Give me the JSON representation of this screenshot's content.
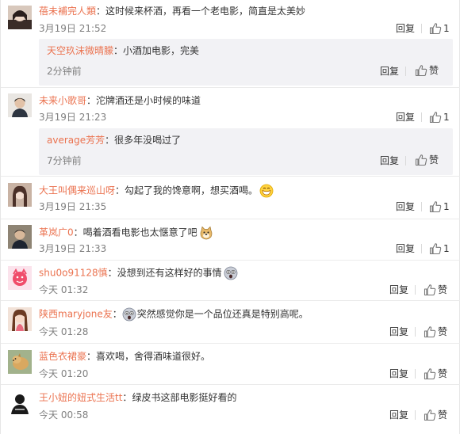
{
  "actions": {
    "reply_label": "回复",
    "like_label": "赞"
  },
  "comments": [
    {
      "user": "蓓未補完人類",
      "text": "这时候来杯酒，再看一个老电影，简直是太美妙",
      "time": "3月19日 21:52",
      "like_value": "1",
      "reply": {
        "user": "天空玖沫微晴朦",
        "text": "小酒加电影，完美",
        "time": "2分钟前"
      }
    },
    {
      "user": "未来小歌哥",
      "text": "沱牌酒还是小时候的味道",
      "time": "3月19日 21:23",
      "like_value": "1",
      "reply": {
        "user": "average芳芳",
        "text": "很多年没喝过了",
        "time": "7分钟前"
      }
    },
    {
      "user": "大王叫偶来巡山呀",
      "text": "勾起了我的馋意啊，想买酒喝。",
      "time": "3月19日 21:35",
      "like_value": "1",
      "emoji": "grin-emoji"
    },
    {
      "user": "革岚广0",
      "text": "喝着酒看电影也太惬意了吧",
      "time": "3月19日 21:33",
      "like_value": "1",
      "emoji": "doge-emoji"
    },
    {
      "user": "shu0o91128慎",
      "text": "没想到还有这样好的事情",
      "time": "今天 01:32",
      "like_value": "赞",
      "emoji": "shocked-emoji"
    },
    {
      "user": "陕西maryjone友",
      "text": "突然感觉你是一个品位还真是特别高呢。",
      "time": "今天 01:28",
      "like_value": "赞",
      "emoji_before": "shocked-emoji"
    },
    {
      "user": "蓝色衣裙豪",
      "text": "喜欢喝，舍得酒味道很好。",
      "time": "今天 01:20",
      "like_value": "赞"
    },
    {
      "user": "王小妞的妞式生活tt",
      "text": "绿皮书这部电影挺好看的",
      "time": "今天 00:58",
      "like_value": "赞"
    }
  ],
  "colors": {
    "username": "#eb7350",
    "meta": "#808080",
    "reply_bg": "#f2f2f5"
  }
}
